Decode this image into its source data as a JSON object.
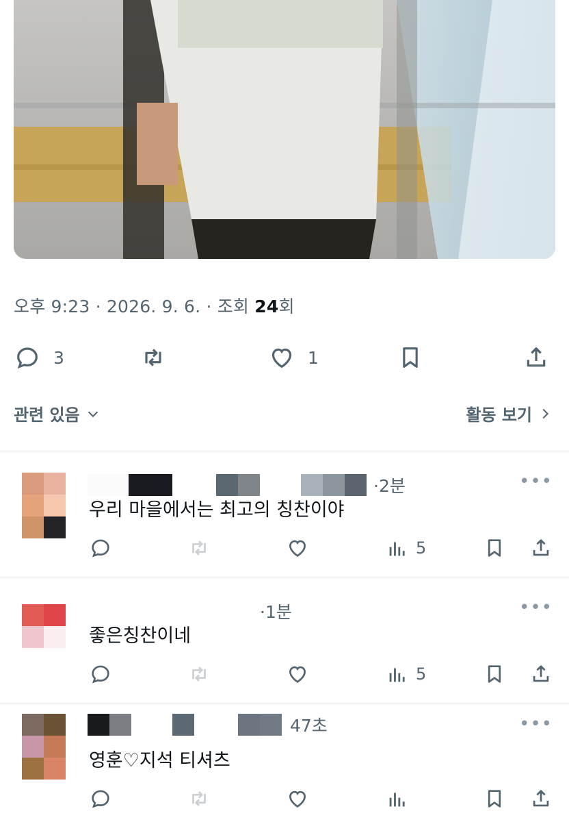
{
  "tweet": {
    "timestamp_prefix": "오후 9:23 · 2026. 9. 6. · 조회 ",
    "views": "24",
    "views_suffix": "회",
    "reply_count": "3",
    "like_count": "1"
  },
  "related": {
    "label": "관련 있음",
    "activity_label": "활동 보기"
  },
  "replies": [
    {
      "time": "·2분",
      "text": "우리 마을에서는 최고의 칭찬이야",
      "views": "5"
    },
    {
      "time": "·1분",
      "text": "좋은칭찬이네",
      "views": "5"
    },
    {
      "time": "47초",
      "text": "영훈♡지석 티셔츠",
      "views": ""
    }
  ],
  "more_glyph": "•••",
  "colors": {
    "text_secondary": "#536471",
    "text_primary": "#0f1419",
    "divider": "#e1e6ea"
  }
}
